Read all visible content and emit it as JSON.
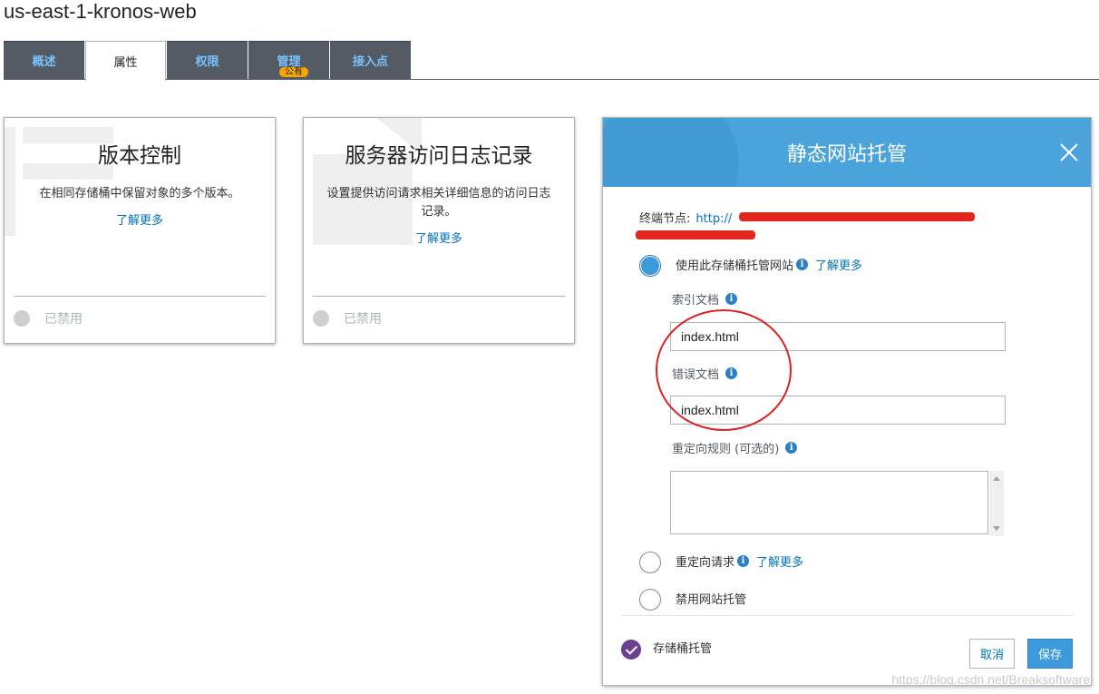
{
  "bucket": {
    "name": "us-east-1-kronos-web"
  },
  "tabs": [
    {
      "label": "概述",
      "active": false
    },
    {
      "label": "属性",
      "active": true
    },
    {
      "label": "权限",
      "active": false
    },
    {
      "label": "管理",
      "active": false,
      "badge": "公有"
    },
    {
      "label": "接入点",
      "active": false
    }
  ],
  "cards": [
    {
      "title": "版本控制",
      "description": "在相同存储桶中保留对象的多个版本。",
      "link": "了解更多",
      "status": "已禁用"
    },
    {
      "title": "服务器访问日志记录",
      "description": "设置提供访问请求相关详细信息的访问日志记录。",
      "link": "了解更多",
      "status": "已禁用"
    }
  ],
  "modal": {
    "title": "静态网站托管",
    "endpoint_label": "终端节点:",
    "endpoint_url": "http://",
    "options": {
      "host": {
        "label": "使用此存储桶托管网站",
        "link": "了解更多",
        "selected": true
      },
      "redirect": {
        "label": "重定向请求",
        "link": "了解更多",
        "selected": false
      },
      "disable": {
        "label": "禁用网站托管",
        "selected": false
      }
    },
    "index_document": {
      "label": "索引文档",
      "value": "index.html"
    },
    "error_document": {
      "label": "错误文档",
      "value": "index.html"
    },
    "redirect_rules": {
      "label": "重定向规则 (可选的)",
      "value": ""
    },
    "footer_status": "存储桶托管",
    "cancel_label": "取消",
    "save_label": "保存"
  },
  "watermark": "https://blog.csdn.net/Breaksoftware",
  "colors": {
    "tab_bg": "#545b64",
    "tab_text": "#79c2ff",
    "header_blue": "#4aa3da",
    "link": "#0073bb",
    "annotation_red": "#e02020",
    "check_purple": "#6b3f8f"
  }
}
